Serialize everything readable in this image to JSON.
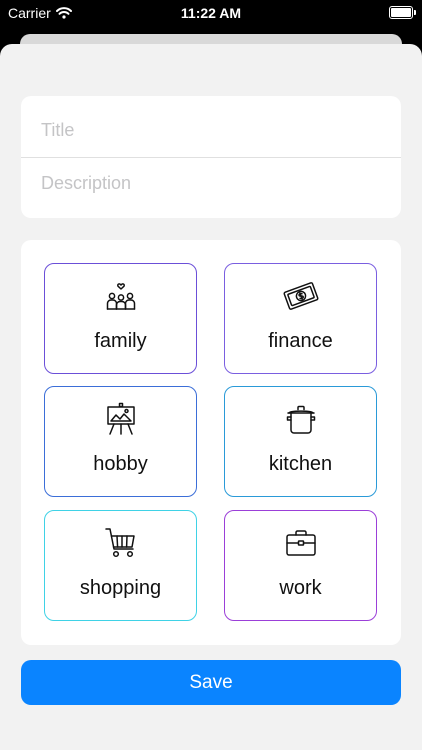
{
  "status_bar": {
    "carrier": "Carrier",
    "time": "11:22 AM"
  },
  "form": {
    "title_placeholder": "Title",
    "description_placeholder": "Description"
  },
  "categories": [
    {
      "label": "family",
      "icon": "family-icon",
      "border_color": "#6b4fd8"
    },
    {
      "label": "finance",
      "icon": "money-icon",
      "border_color": "#7a5ee0"
    },
    {
      "label": "hobby",
      "icon": "easel-icon",
      "border_color": "#3b6ed8"
    },
    {
      "label": "kitchen",
      "icon": "cooking-pot-icon",
      "border_color": "#2a9ad8"
    },
    {
      "label": "shopping",
      "icon": "shopping-cart-icon",
      "border_color": "#3fd2e6"
    },
    {
      "label": "work",
      "icon": "briefcase-icon",
      "border_color": "#9b3fd8"
    }
  ],
  "save_label": "Save",
  "colors": {
    "accent": "#0a84ff",
    "sheet_background": "#f2f2f2"
  }
}
